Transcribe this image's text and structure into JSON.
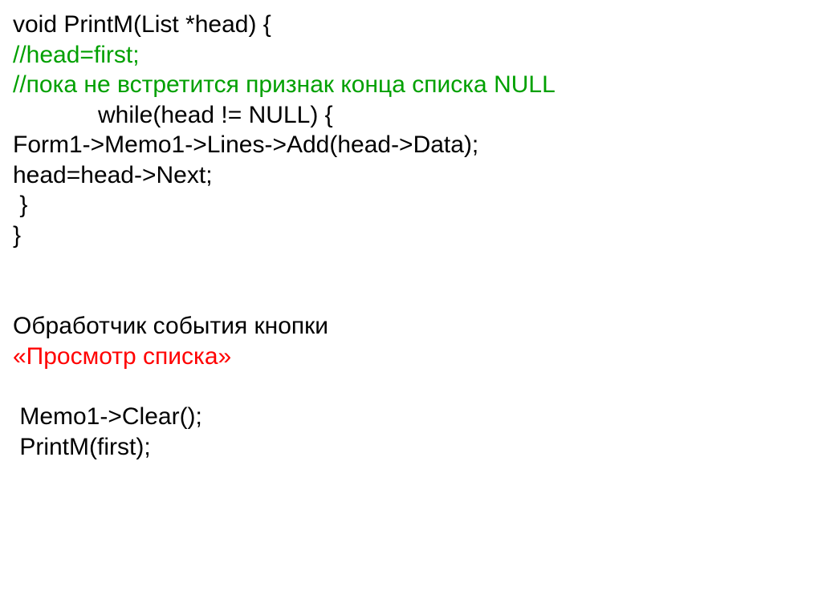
{
  "code": {
    "line1": "void PrintM(List *head) {",
    "line2": "//head=first;",
    "line3": "//пока не встретится признак конца списка NULL",
    "line4": "while(head != NULL) {",
    "line5": "Form1->Memo1->Lines->Add(head->Data);",
    "line6": "head=head->Next;",
    "line7": " }",
    "line8": "}"
  },
  "handler": {
    "title_black": "Обработчик события кнопки",
    "title_red": "«Просмотр списка»",
    "call1": " Memo1->Clear();",
    "call2": " PrintM(first);"
  }
}
